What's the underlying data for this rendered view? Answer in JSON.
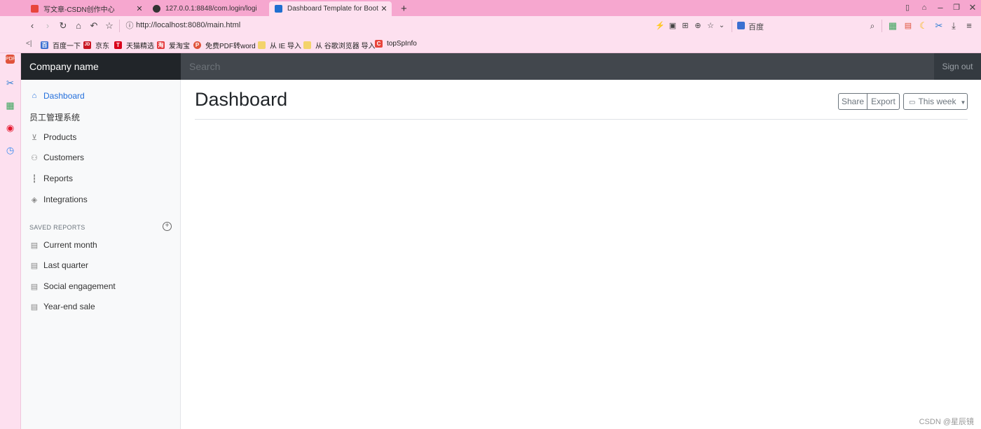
{
  "browser": {
    "tabs": [
      {
        "title": "写文章-CSDN创作中心",
        "icon": "csdn-icon",
        "color": "#e8453c"
      },
      {
        "title": "127.0.0.1:8848/com.login/logi",
        "icon": "globe-icon",
        "color": "#333333"
      },
      {
        "title": "Dashboard Template for Boot",
        "icon": "page-icon",
        "color": "#1f6fd0"
      }
    ],
    "new_tab": "+",
    "url": "http://localhost:8080/main.html",
    "search_engine": "百度",
    "bookmarks": [
      {
        "label": "百度一下",
        "color": "#3b6fd1",
        "glyph": "百"
      },
      {
        "label": "京东",
        "color": "#c91623",
        "glyph": "JD"
      },
      {
        "label": "天猫精选",
        "color": "#d9001b",
        "glyph": "T"
      },
      {
        "label": "爱淘宝",
        "color": "#e4393c",
        "glyph": "淘"
      },
      {
        "label": "免费PDF转word",
        "color": "#e0533b",
        "glyph": "P"
      },
      {
        "label": "从 IE 导入",
        "color": "#f3d36b",
        "glyph": ""
      },
      {
        "label": "从 谷歌浏览器 导入",
        "color": "#f3d36b",
        "glyph": ""
      },
      {
        "label": "topSpInfo",
        "color": "#e8453c",
        "glyph": "C"
      }
    ]
  },
  "app": {
    "brand": "Company name",
    "search_placeholder": "Search",
    "signout": "Sign out",
    "nav": [
      {
        "label": "Dashboard",
        "icon": "home-icon",
        "active": true
      },
      {
        "label": "员工管理系统",
        "icon": "",
        "active": false
      },
      {
        "label": "Products",
        "icon": "cart-icon",
        "active": false
      },
      {
        "label": "Customers",
        "icon": "users-icon",
        "active": false
      },
      {
        "label": "Reports",
        "icon": "bar-chart-icon",
        "active": false
      },
      {
        "label": "Integrations",
        "icon": "layers-icon",
        "active": false
      }
    ],
    "saved_reports_heading": "SAVED REPORTS",
    "saved_reports": [
      {
        "label": "Current month",
        "icon": "file-icon"
      },
      {
        "label": "Last quarter",
        "icon": "file-icon"
      },
      {
        "label": "Social engagement",
        "icon": "file-icon"
      },
      {
        "label": "Year-end sale",
        "icon": "file-icon"
      }
    ],
    "page_title": "Dashboard",
    "share": "Share",
    "export": "Export",
    "period": "This week"
  },
  "watermark": "CSDN @星辰镜",
  "colors": {
    "accent": "#2470dc",
    "chrome": "#f6a7cf",
    "navbar": "#343a40"
  }
}
